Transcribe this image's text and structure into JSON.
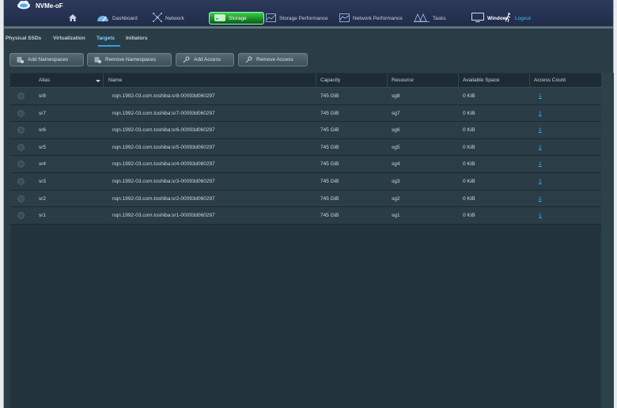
{
  "app": {
    "title": "NVMe-oF"
  },
  "nav": {
    "home_icon": "home-icon",
    "items": [
      {
        "label": "Dashboard",
        "icon": "gauge-icon"
      },
      {
        "label": "Network",
        "icon": "network-icon"
      },
      {
        "label": "Storage",
        "icon": "drive-icon",
        "active": true
      },
      {
        "label": "Storage Performance",
        "icon": "chart-icon"
      },
      {
        "label": "Network Performance",
        "icon": "chart-icon"
      },
      {
        "label": "Tasks",
        "icon": "tasks-icon"
      }
    ],
    "window_label": "Window",
    "logout_label": "Logout"
  },
  "tabs": [
    {
      "label": "Physical SSDs"
    },
    {
      "label": "Virtualization"
    },
    {
      "label": "Targets",
      "active": true
    },
    {
      "label": "Initiators"
    }
  ],
  "toolbar": {
    "add_namespaces": "Add Namespaces",
    "remove_namespaces": "Remove Namespaces",
    "add_access": "Add Access",
    "remove_access": "Remove Access"
  },
  "table": {
    "columns": [
      "Alias",
      "Name",
      "Capacity",
      "Resource",
      "Available Space",
      "Access Count"
    ],
    "rows": [
      {
        "alias": "sr8",
        "name": "nqn.1992-03.com.toshiba:sr8-00093d060297",
        "capacity": "745 GiB",
        "resource": "sg8",
        "available": "0 KiB",
        "access": "1"
      },
      {
        "alias": "sr7",
        "name": "nqn.1992-03.com.toshiba:sr7-00093d060297",
        "capacity": "745 GiB",
        "resource": "sg7",
        "available": "0 KiB",
        "access": "1"
      },
      {
        "alias": "sr6",
        "name": "nqn.1992-03.com.toshiba:sr6-00093d060297",
        "capacity": "745 GiB",
        "resource": "sg6",
        "available": "0 KiB",
        "access": "1"
      },
      {
        "alias": "sr5",
        "name": "nqn.1992-03.com.toshiba:sr5-00093d060297",
        "capacity": "745 GiB",
        "resource": "sg5",
        "available": "0 KiB",
        "access": "1"
      },
      {
        "alias": "sr4",
        "name": "nqn.1992-03.com.toshiba:sr4-00093d060297",
        "capacity": "745 GiB",
        "resource": "sg4",
        "available": "0 KiB",
        "access": "1"
      },
      {
        "alias": "sr3",
        "name": "nqn.1992-03.com.toshiba:sr3-00093d060297",
        "capacity": "745 GiB",
        "resource": "sg3",
        "available": "0 KiB",
        "access": "1"
      },
      {
        "alias": "sr2",
        "name": "nqn.1992-03.com.toshiba:sr2-00093d060297",
        "capacity": "745 GiB",
        "resource": "sg2",
        "available": "0 KiB",
        "access": "1"
      },
      {
        "alias": "sr1",
        "name": "nqn.1992-03.com.toshiba:sr1-00093d060297",
        "capacity": "745 GiB",
        "resource": "sg1",
        "available": "0 KiB",
        "access": "1"
      }
    ]
  },
  "colors": {
    "accent": "#33a0e0",
    "active_nav": "#2bb83a",
    "link": "#35b5ff",
    "background": "#2a3d47"
  }
}
